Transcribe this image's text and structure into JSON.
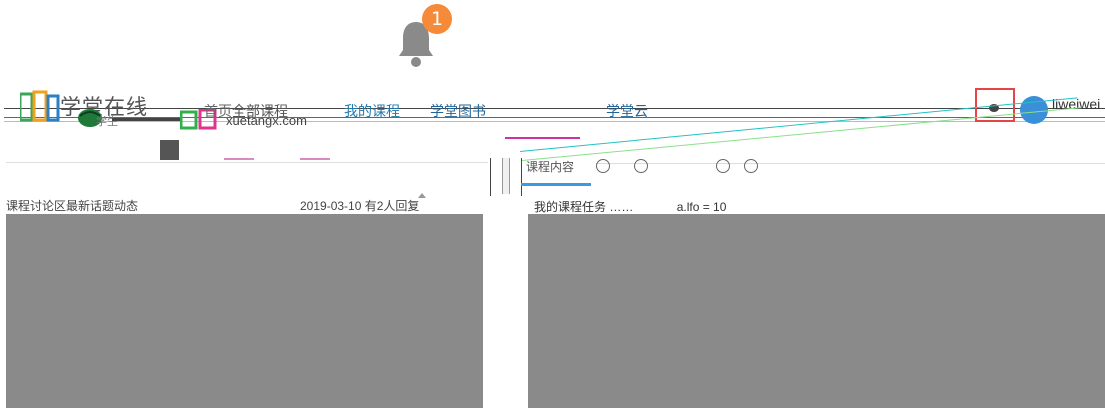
{
  "notifications": {
    "count": "1"
  },
  "header": {
    "logo_title": "学堂在线",
    "logo_sub": "学生",
    "domain_text": "xuetangx.com",
    "nav": {
      "home": "首页",
      "all_courses": "全部课程",
      "my_courses": "我的课程",
      "library": "学堂图书",
      "extra": "",
      "school": "学堂云"
    },
    "username": "liweiwei"
  },
  "tabs": {
    "active_label": "课程内容"
  },
  "content": {
    "left_row_text": "课程讨论区最新话题动态",
    "left_row_date": "2019-03-10 有2人回复",
    "right_row_text": "我的课程任务 ……",
    "right_row_expr": "a.lfo = 10"
  },
  "colors": {
    "badge": "#f58a38",
    "accent_pink": "#d02fa5",
    "accent_blue": "#3a9be0",
    "search_border": "#e64545",
    "panel_gray": "#8a8a8a"
  }
}
